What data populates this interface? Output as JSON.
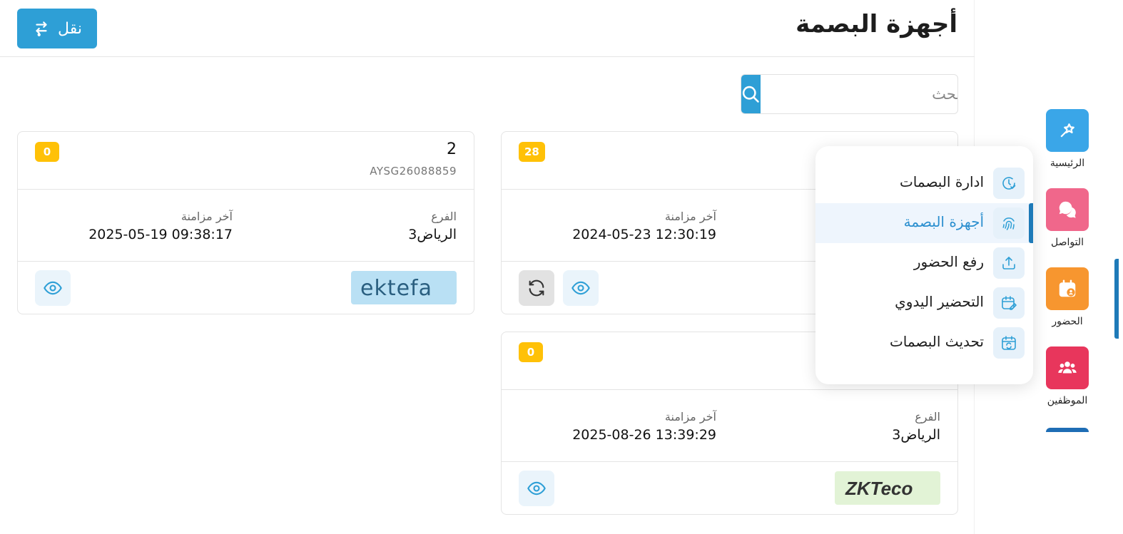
{
  "header": {
    "title": "أجهزة البصمة",
    "move_button_label": "نقل"
  },
  "search": {
    "placeholder": "ابحث"
  },
  "labels": {
    "branch": "الفرع",
    "last_sync": "آخر مزامنة"
  },
  "devices": [
    {
      "count": "28",
      "branch": "",
      "last_sync": "2024-05-23 12:30:19",
      "actions": [
        "sync",
        "view"
      ]
    },
    {
      "name": "2",
      "serial": "AYSG26088859",
      "count": "0",
      "branch": "الرياض3",
      "last_sync": "2025-05-19 09:38:17",
      "brand": "ektefa",
      "actions": [
        "view"
      ]
    },
    {
      "count": "0",
      "branch": "الرياض3",
      "last_sync": "2025-08-26 13:39:29",
      "brand": "ZKTeco",
      "actions": [
        "view"
      ]
    }
  ],
  "submenu": {
    "items": [
      {
        "label": "ادارة البصمات",
        "icon": "clock-check-icon",
        "active": false
      },
      {
        "label": "أجهزة البصمة",
        "icon": "fingerprint-icon",
        "active": true
      },
      {
        "label": "رفع الحضور",
        "icon": "upload-icon",
        "active": false
      },
      {
        "label": "التحضير اليدوي",
        "icon": "calendar-edit-icon",
        "active": false
      },
      {
        "label": "تحديث البصمات",
        "icon": "calendar-sync-icon",
        "active": false
      }
    ]
  },
  "sidebar": {
    "items": [
      {
        "label": "الرئيسية",
        "icon": "magic-star-icon",
        "color": "#3aa6e8"
      },
      {
        "label": "التواصل",
        "icon": "chat-icon",
        "color": "#f0678b"
      },
      {
        "label": "الحضور",
        "icon": "calendar-user-icon",
        "color": "#f7962f",
        "active": true
      },
      {
        "label": "الموظفين",
        "icon": "users-icon",
        "color": "#e8365c"
      }
    ]
  },
  "colors": {
    "primary": "#2e9fd6",
    "badge": "#ffc107",
    "active_accent": "#1e7ab8"
  }
}
